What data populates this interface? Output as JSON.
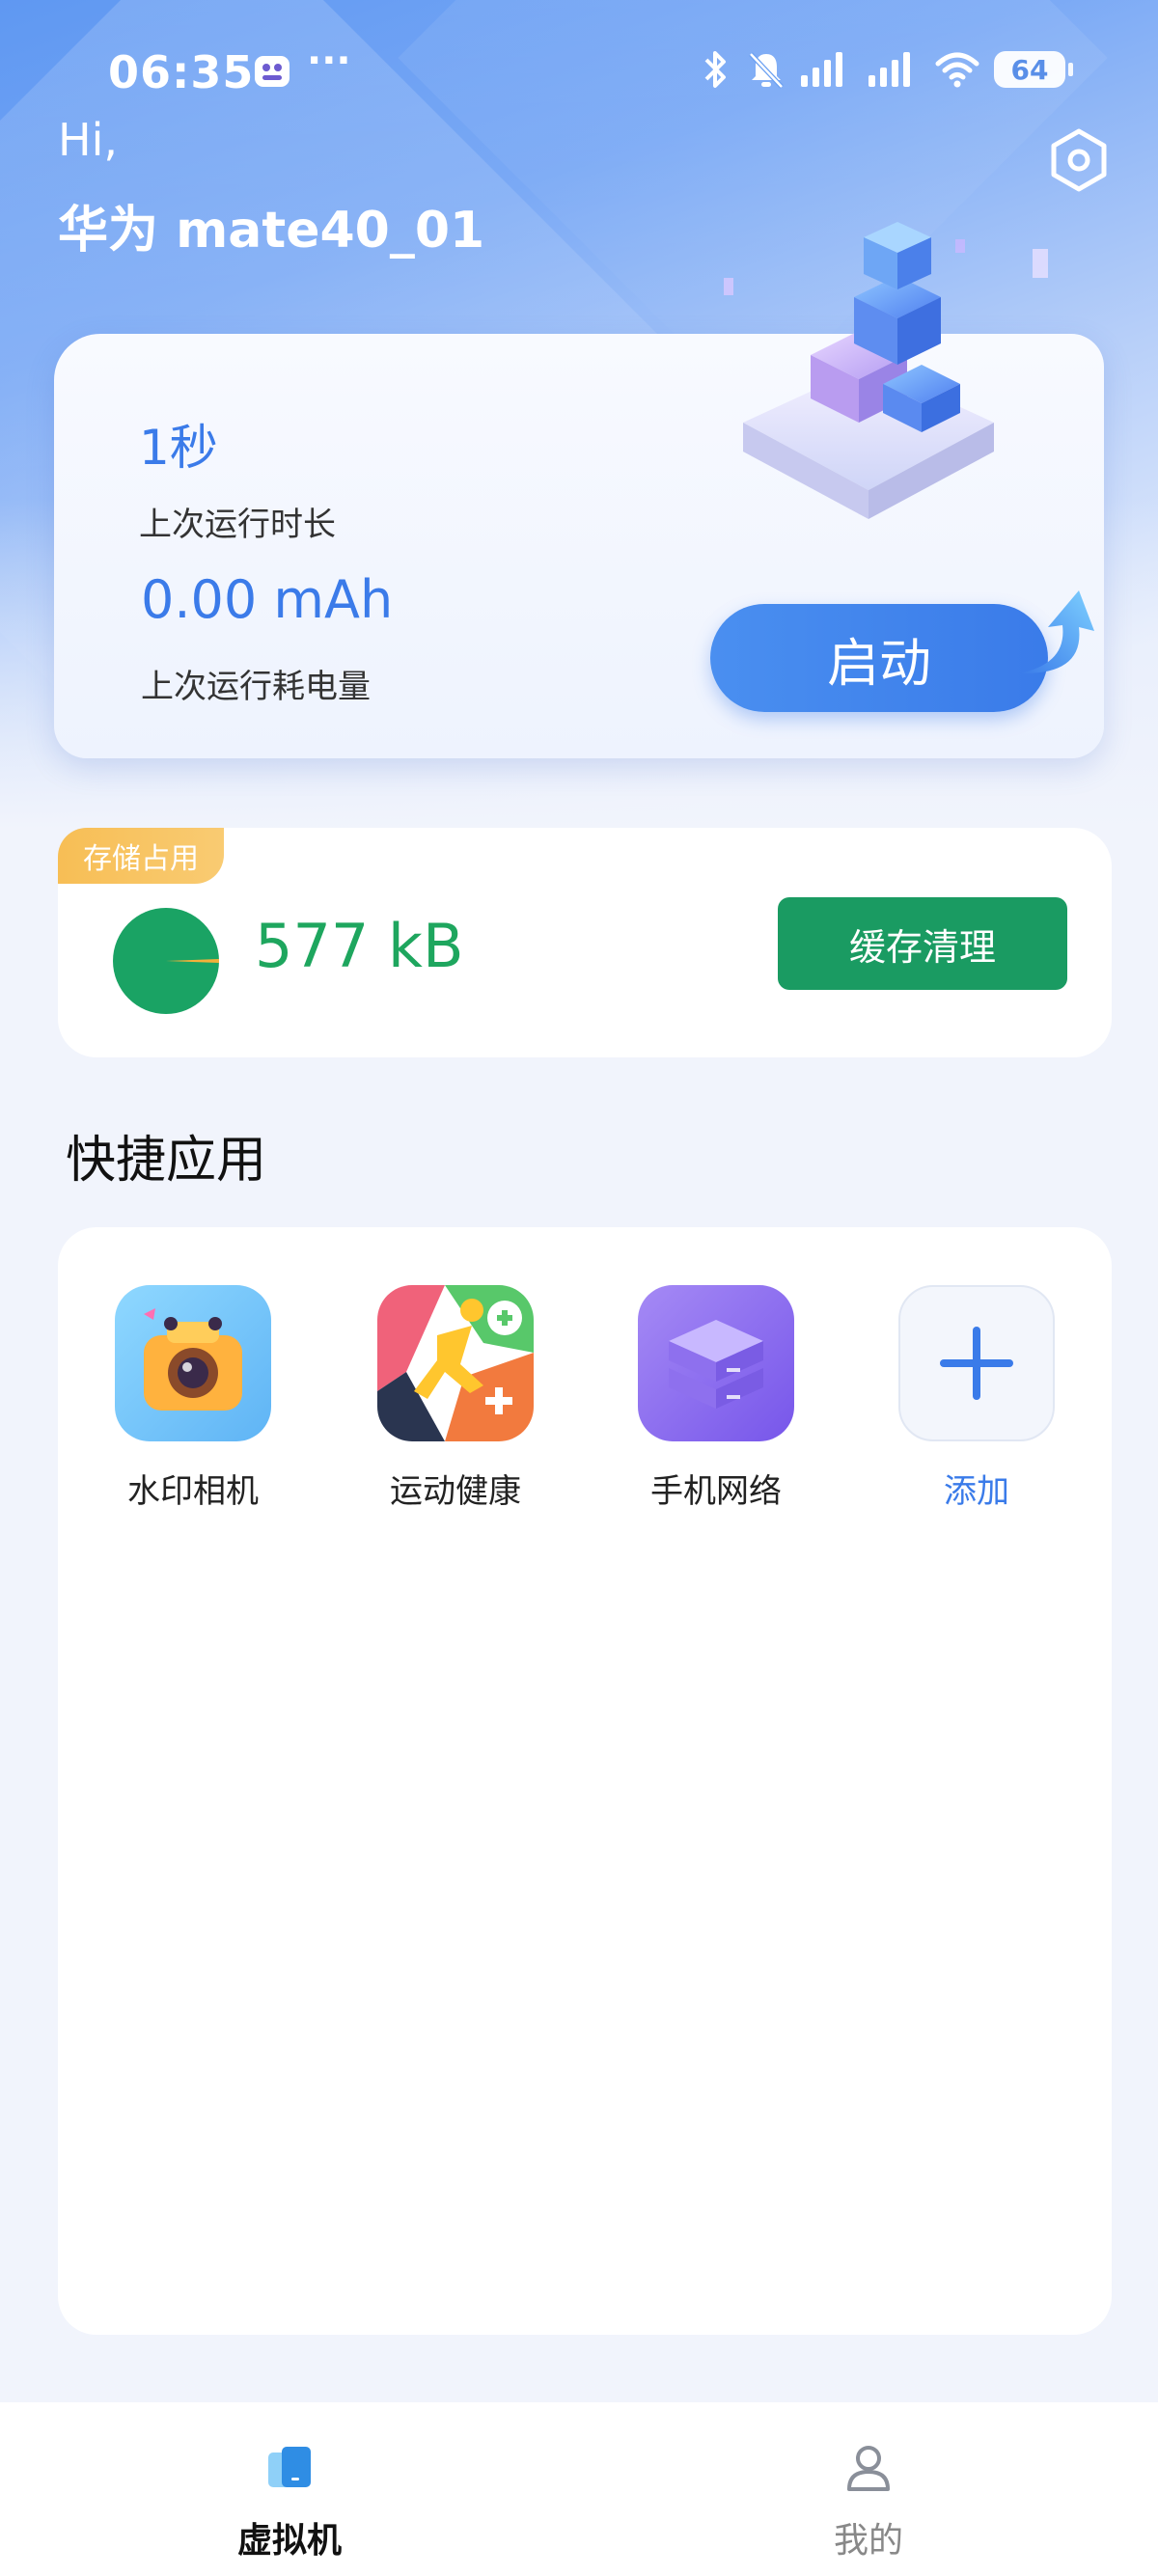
{
  "status_bar": {
    "time": "06:35",
    "more": "···",
    "battery": "64"
  },
  "header": {
    "greeting": "Hi,",
    "device_name": "华为 mate40_01"
  },
  "run_card": {
    "last_runtime_value": "1秒",
    "last_runtime_label": "上次运行时长",
    "last_power_value": "0.00 mAh",
    "last_power_label": "上次运行耗电量",
    "start_label": "启动"
  },
  "storage": {
    "tag": "存储占用",
    "value": "577 kB",
    "clear_label": "缓存清理"
  },
  "quick_apps": {
    "title": "快捷应用",
    "apps": [
      {
        "label": "水印相机"
      },
      {
        "label": "运动健康"
      },
      {
        "label": "手机网络"
      },
      {
        "label": "添加"
      }
    ]
  },
  "nav": {
    "vm_label": "虚拟机",
    "me_label": "我的"
  },
  "colors": {
    "accent": "#3b7be9",
    "storage_green": "#1ea65e",
    "clear_button": "#1a9b62",
    "tag_orange": "#f7be55"
  }
}
